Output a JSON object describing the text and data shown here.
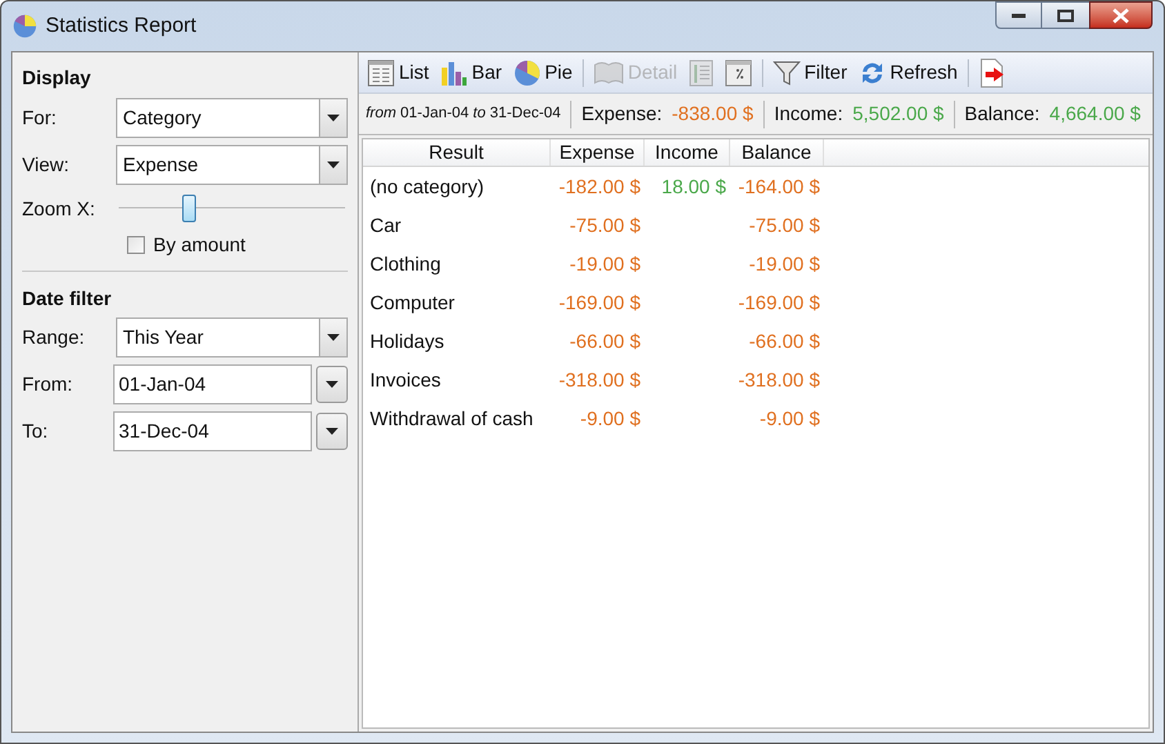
{
  "window": {
    "title": "Statistics Report"
  },
  "display": {
    "heading": "Display",
    "for": {
      "label": "For:",
      "value": "Category"
    },
    "view": {
      "label": "View:",
      "value": "Expense"
    },
    "zoom": {
      "label": "Zoom X:",
      "level": 0.3
    },
    "by_amount": {
      "label": "By amount",
      "checked": false
    }
  },
  "date_filter": {
    "heading": "Date filter",
    "range": {
      "label": "Range:",
      "value": "This Year"
    },
    "from": {
      "label": "From:",
      "value": "01-Jan-04"
    },
    "to": {
      "label": "To:",
      "value": "31-Dec-04"
    }
  },
  "toolbar": [
    {
      "kind": "list",
      "label": "List",
      "disabled": false
    },
    {
      "kind": "bar",
      "label": "Bar",
      "disabled": false
    },
    {
      "kind": "pie",
      "label": "Pie",
      "disabled": false
    },
    {
      "kind": "sep"
    },
    {
      "kind": "detail",
      "label": "Detail",
      "disabled": true
    },
    {
      "kind": "columns",
      "disabled": true
    },
    {
      "kind": "percent",
      "disabled": false
    },
    {
      "kind": "sep"
    },
    {
      "kind": "filter",
      "label": "Filter",
      "disabled": false
    },
    {
      "kind": "refresh",
      "label": "Refresh",
      "disabled": false
    },
    {
      "kind": "sep"
    },
    {
      "kind": "exit",
      "disabled": false
    }
  ],
  "summary": {
    "period": "*from* 01-Jan-04 *to* 31-Dec-04",
    "items": [
      {
        "label": "Expense:",
        "value": "-838.00 $",
        "color": "#e07020"
      },
      {
        "label": "Income:",
        "value": "5,502.00 $",
        "color": "#4aa84a"
      },
      {
        "label": "Balance:",
        "value": "4,664.00 $",
        "color": "#4aa84a"
      }
    ]
  },
  "table": {
    "columns": [
      "Result",
      "Expense",
      "Income",
      "Balance"
    ],
    "rows": [
      {
        "result": "(no category)",
        "expense": {
          "text": "-182.00 $",
          "color": "#e07020"
        },
        "income": {
          "text": "18.00 $",
          "color": "#4aa84a"
        },
        "balance": {
          "text": "-164.00 $",
          "color": "#e07020"
        }
      },
      {
        "result": "Car",
        "expense": {
          "text": "-75.00 $",
          "color": "#e07020"
        },
        "balance": {
          "text": "-75.00 $",
          "color": "#e07020"
        }
      },
      {
        "result": "Clothing",
        "expense": {
          "text": "-19.00 $",
          "color": "#e07020"
        },
        "balance": {
          "text": "-19.00 $",
          "color": "#e07020"
        }
      },
      {
        "result": "Computer",
        "expense": {
          "text": "-169.00 $",
          "color": "#e07020"
        },
        "balance": {
          "text": "-169.00 $",
          "color": "#e07020"
        }
      },
      {
        "result": "Holidays",
        "expense": {
          "text": "-66.00 $",
          "color": "#e07020"
        },
        "balance": {
          "text": "-66.00 $",
          "color": "#e07020"
        }
      },
      {
        "result": "Invoices",
        "expense": {
          "text": "-318.00 $",
          "color": "#e07020"
        },
        "balance": {
          "text": "-318.00 $",
          "color": "#e07020"
        }
      },
      {
        "result": "Withdrawal of cash",
        "expense": {
          "text": "-9.00 $",
          "color": "#e07020"
        },
        "balance": {
          "text": "-9.00 $",
          "color": "#e07020"
        }
      }
    ]
  }
}
